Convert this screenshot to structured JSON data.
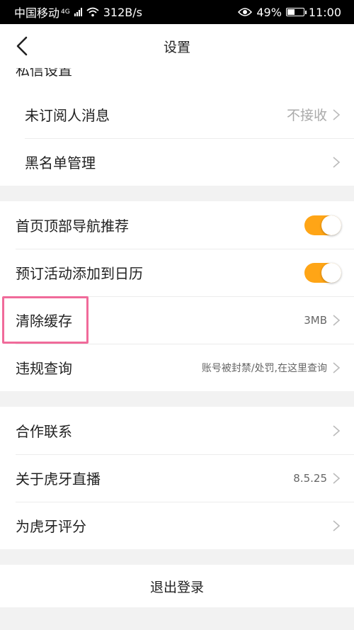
{
  "status_bar": {
    "carrier": "中国移动",
    "network": "4G",
    "speed": "312B/s",
    "battery_percent": "49%",
    "battery_level": 0.49,
    "time": "11:00"
  },
  "nav": {
    "title": "设置",
    "back_icon": "chevron-left-icon"
  },
  "section_cut_label": "私信设置",
  "groups": {
    "privacy": [
      {
        "label": "未订阅人消息",
        "value": "不接收"
      },
      {
        "label": "黑名单管理",
        "value": ""
      }
    ],
    "general": {
      "nav_recommend_label": "首页顶部导航推荐",
      "nav_recommend_on": true,
      "calendar_label": "预订活动添加到日历",
      "calendar_on": true,
      "clear_cache_label": "清除缓存",
      "clear_cache_value": "3MB",
      "violation_label": "违规查询",
      "violation_value": "账号被封禁/处罚,在这里查询"
    },
    "about": [
      {
        "label": "合作联系",
        "value": ""
      },
      {
        "label": "关于虎牙直播",
        "value": "8.5.25"
      },
      {
        "label": "为虎牙评分",
        "value": ""
      }
    ]
  },
  "logout_label": "退出登录",
  "colors": {
    "toggle_on": "#ffa516",
    "highlight": "#f06b9a"
  }
}
